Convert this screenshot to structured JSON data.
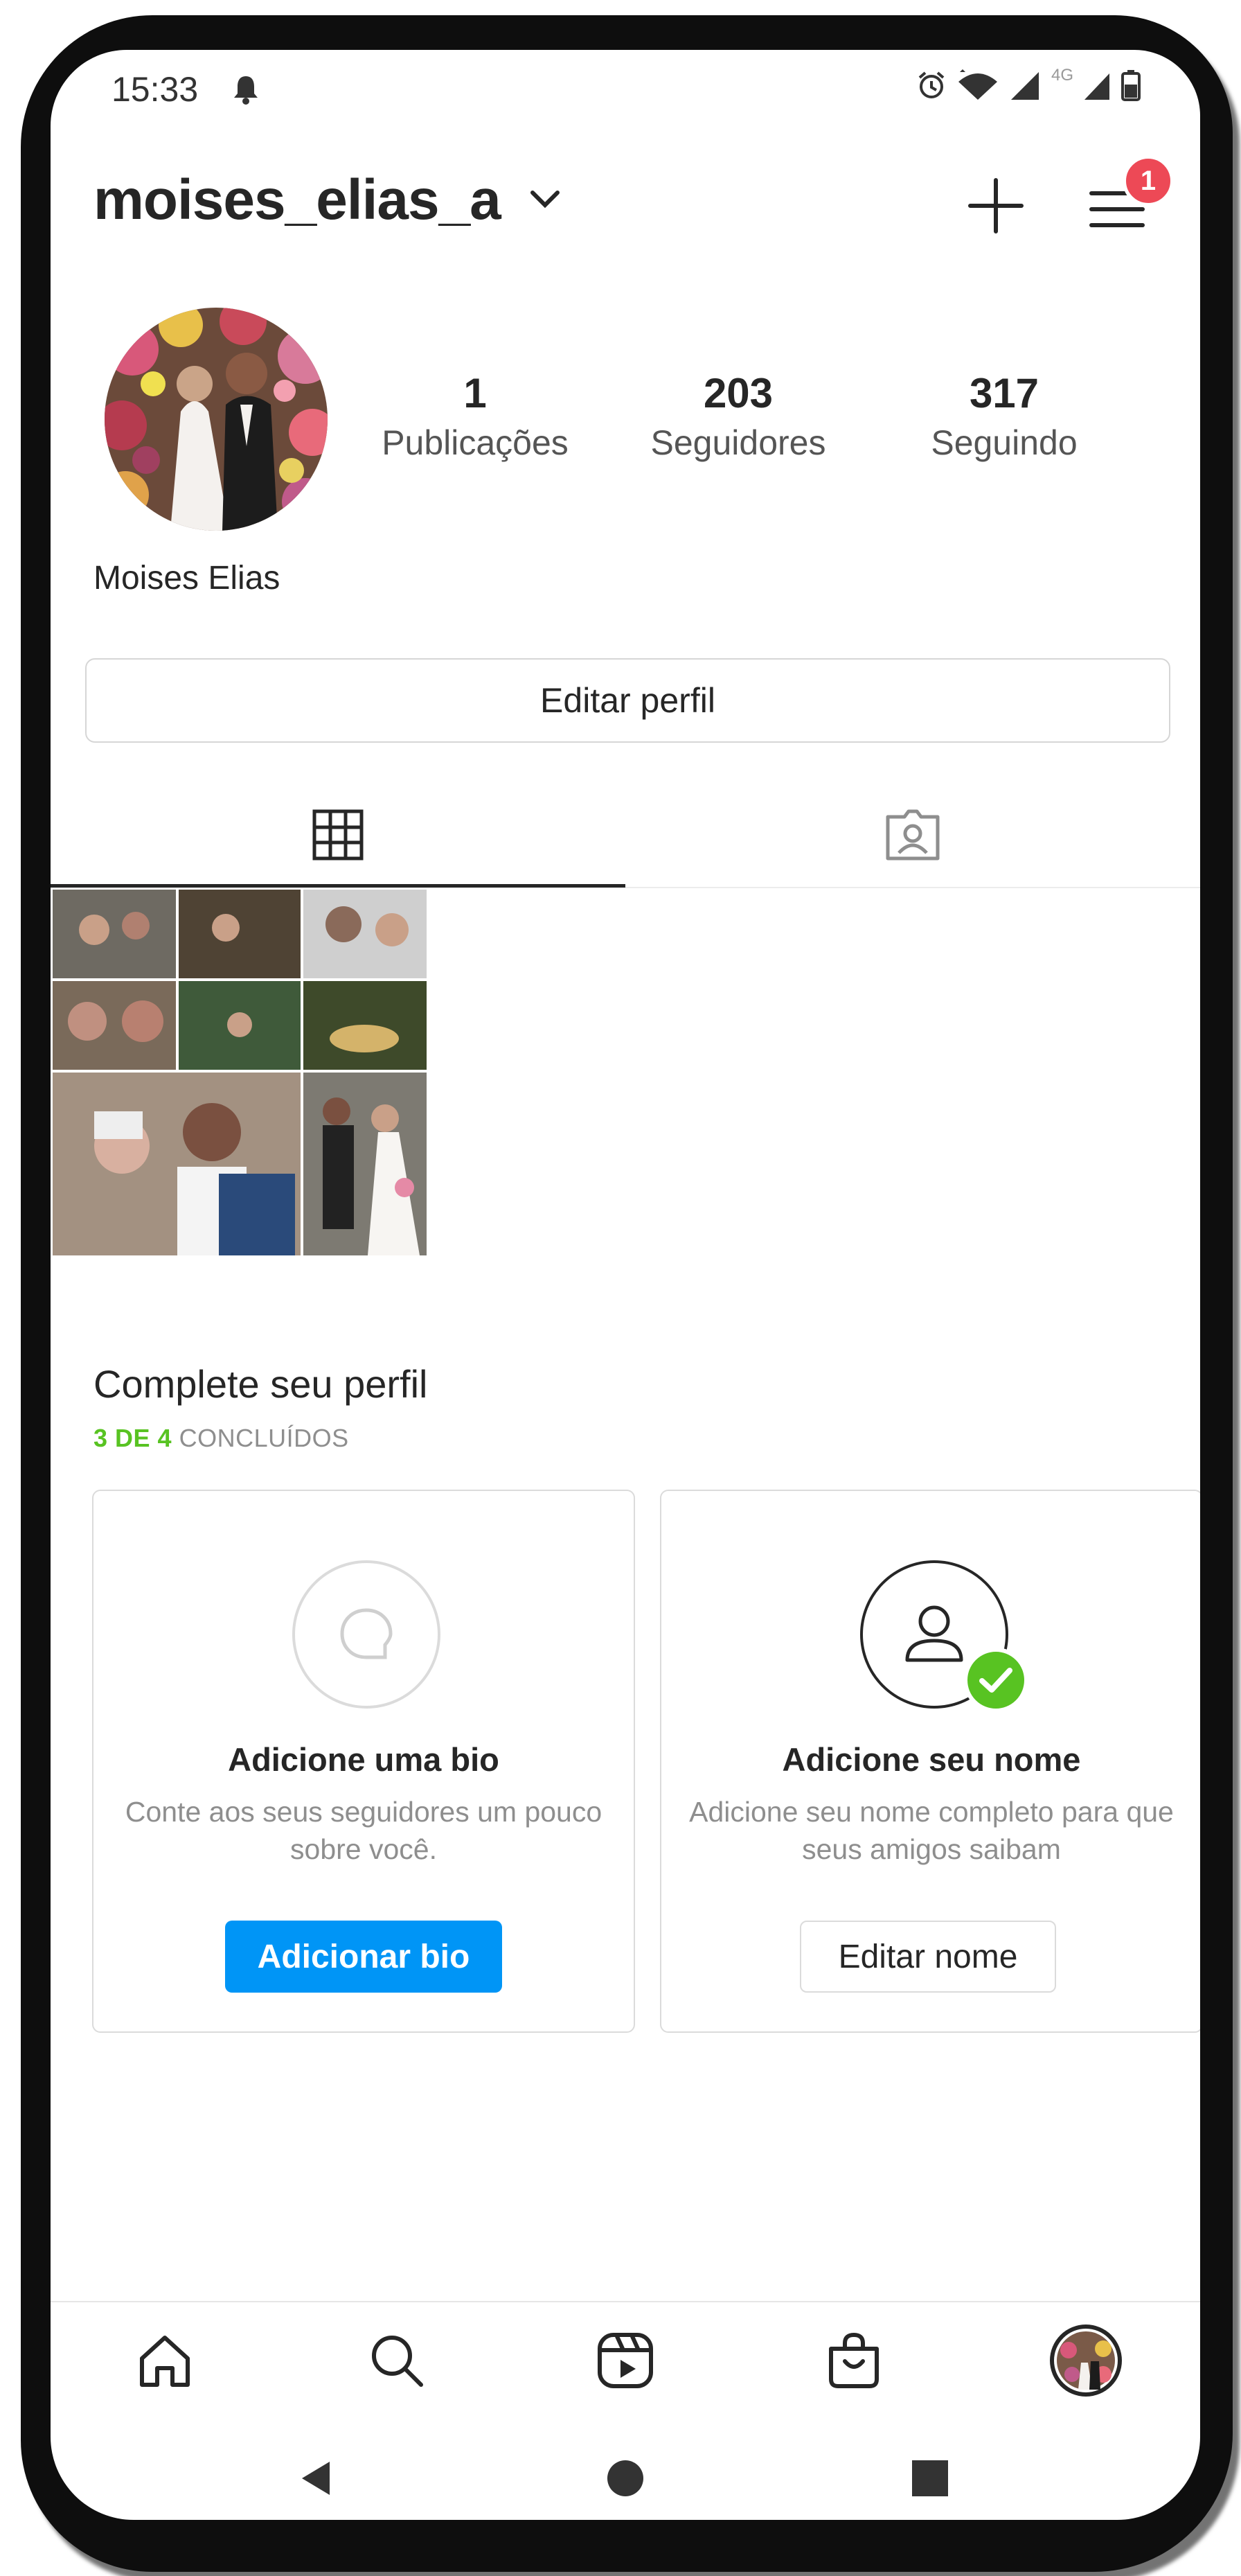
{
  "status_bar": {
    "time": "15:33",
    "network": "4G"
  },
  "header": {
    "username": "moises_elias_a",
    "notification_count": "1"
  },
  "profile": {
    "full_name": "Moises Elias",
    "stats": [
      {
        "value": "1",
        "label": "Publicações"
      },
      {
        "value": "203",
        "label": "Seguidores"
      },
      {
        "value": "317",
        "label": "Seguindo"
      }
    ],
    "edit_label": "Editar perfil"
  },
  "complete_profile": {
    "title": "Complete seu perfil",
    "progress_done": "3 DE 4",
    "progress_label": "CONCLUÍDOS",
    "cards": [
      {
        "title": "Adicione uma bio",
        "description": "Conte aos seus seguidores um pouco sobre você.",
        "button": "Adicionar bio",
        "completed": false
      },
      {
        "title": "Adicione seu nome",
        "description": "Adicione seu nome completo para que seus amigos saibam",
        "button": "Editar nome",
        "completed": true
      }
    ]
  },
  "colors": {
    "accent": "#0095f6",
    "badge": "#ed4956",
    "success": "#58c322",
    "text": "#262626"
  }
}
